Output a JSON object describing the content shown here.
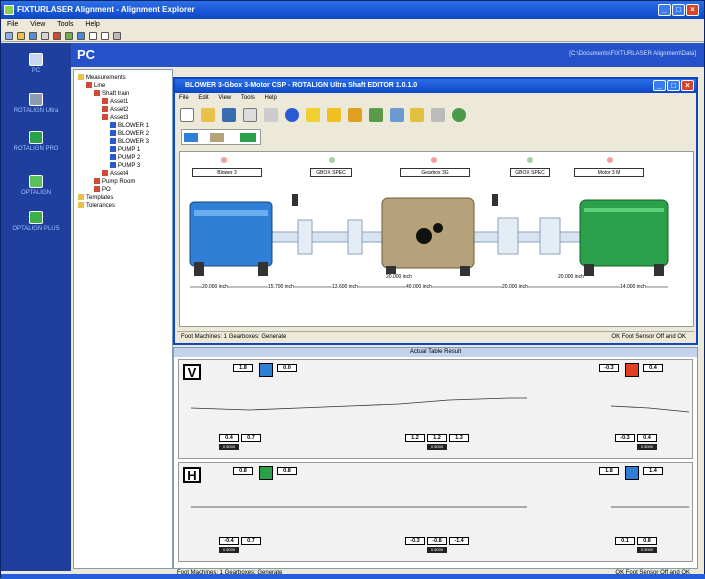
{
  "app": {
    "title": "FIXTURLASER Alignment - Alignment Explorer",
    "menu": [
      "File",
      "View",
      "Tools",
      "Help"
    ]
  },
  "header": {
    "title": "PC",
    "path": "[C:\\Documents\\FIXTURLASER Alignment\\Data]"
  },
  "nav": {
    "items": [
      {
        "label": "PC"
      },
      {
        "label": "ROTALIGN Ultra"
      },
      {
        "label": "ROTALIGN PRO"
      },
      {
        "label": "OPTALIGN"
      },
      {
        "label": "OPTALIGN PLUS"
      }
    ]
  },
  "tree": {
    "items": [
      {
        "label": "Measurements",
        "level": 0
      },
      {
        "label": "Line",
        "level": 1
      },
      {
        "label": "Shaft train",
        "level": 2
      },
      {
        "label": "Asset1",
        "level": 3
      },
      {
        "label": "Asset2",
        "level": 3
      },
      {
        "label": "Asset3",
        "level": 3
      },
      {
        "label": "BLOWER 1",
        "level": 4
      },
      {
        "label": "BLOWER 2",
        "level": 4
      },
      {
        "label": "BLOWER 3",
        "level": 4
      },
      {
        "label": "PUMP 1",
        "level": 4
      },
      {
        "label": "PUMP 2",
        "level": 4
      },
      {
        "label": "PUMP 3",
        "level": 4
      },
      {
        "label": "Asset4",
        "level": 3
      },
      {
        "label": "Pump Room",
        "level": 2
      },
      {
        "label": "PO",
        "level": 2
      },
      {
        "label": "Templates",
        "level": 0
      },
      {
        "label": "Tolerances",
        "level": 0
      }
    ]
  },
  "editor": {
    "title": "BLOWER 3-Gbox 3-Motor CSP - ROTALIGN Ultra Shaft EDITOR 1.0.1.0",
    "menu": [
      "File",
      "Edit",
      "View",
      "Tools",
      "Help"
    ],
    "machines": [
      {
        "label": "Blower 3"
      },
      {
        "label": "GBOX SPEC"
      },
      {
        "label": "Gearbox 3G"
      },
      {
        "label": "GBOX SPEC"
      },
      {
        "label": "Motor 3 M"
      }
    ],
    "dims": [
      "20.000 inch",
      "15.700 inch",
      "13.600 inch",
      "40.000 inch",
      "20.000 inch",
      "14.000 inch"
    ],
    "dim_labels": [
      "20.000 inch",
      "20.000 inch"
    ],
    "status_left": "Foot Machines: 1 Gearboxes: Generate",
    "status_right": "OK Foot Sensor Off and OK"
  },
  "results": {
    "header": "Actual Table Result",
    "v_letter": "V",
    "h_letter": "H",
    "v_top_left": [
      "1.8",
      "0.0"
    ],
    "v_top_right": [
      "-0.3",
      "0.4"
    ],
    "v_bottom_left": [
      "0.4",
      "0.7"
    ],
    "v_bottom_mid": [
      "1.2",
      "1.2",
      "1.3"
    ],
    "v_bottom_right": [
      "-0.3",
      "0.4"
    ],
    "h_top_left": [
      "0.8",
      "0.8"
    ],
    "h_top_right": [
      "1.8",
      "1.4"
    ],
    "h_bottom_left": [
      "-0.4",
      "0.7"
    ],
    "h_bottom_mid": [
      "-0.3",
      "-0.8",
      "-1.4"
    ],
    "h_bottom_right": [
      "0.1",
      "0.8"
    ],
    "tol_label": "0.5000"
  },
  "bottom_status": {
    "left": "Foot Machines: 1 Gearboxes: Generate",
    "right": "OK Foot Sensor Off and OK"
  },
  "colors": {
    "titlebar": "#0d45c8",
    "nav": "#1f3f9e",
    "blower": "#2f7fd6",
    "gearbox": "#b5a27a",
    "motor": "#2aa04a"
  }
}
